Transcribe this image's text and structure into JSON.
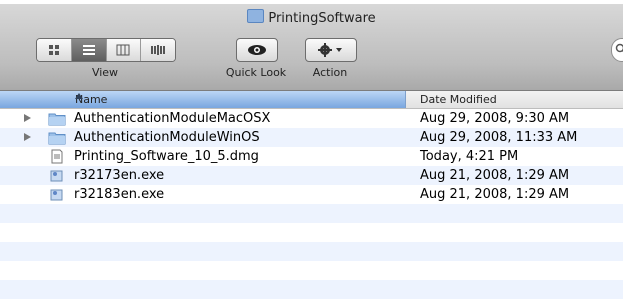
{
  "window": {
    "title": "PrintingSoftware"
  },
  "toolbar": {
    "view_label": "View",
    "quicklook_label": "Quick Look",
    "action_label": "Action"
  },
  "columns": {
    "name": "Name",
    "date": "Date Modified"
  },
  "files": [
    {
      "name": "AuthenticationModuleMacOSX",
      "date": "Aug 29, 2008, 9:30 AM",
      "kind": "folder"
    },
    {
      "name": "AuthenticationModuleWinOS",
      "date": "Aug 29, 2008, 11:33 AM",
      "kind": "folder"
    },
    {
      "name": "Printing_Software_10_5.dmg",
      "date": "Today, 4:21 PM",
      "kind": "dmg"
    },
    {
      "name": "r32173en.exe",
      "date": "Aug 21, 2008, 1:29 AM",
      "kind": "exe"
    },
    {
      "name": "r32183en.exe",
      "date": "Aug 21, 2008, 1:29 AM",
      "kind": "exe"
    }
  ],
  "colors": {
    "selection": "#79a6df",
    "stripe": "#edf3fe"
  }
}
